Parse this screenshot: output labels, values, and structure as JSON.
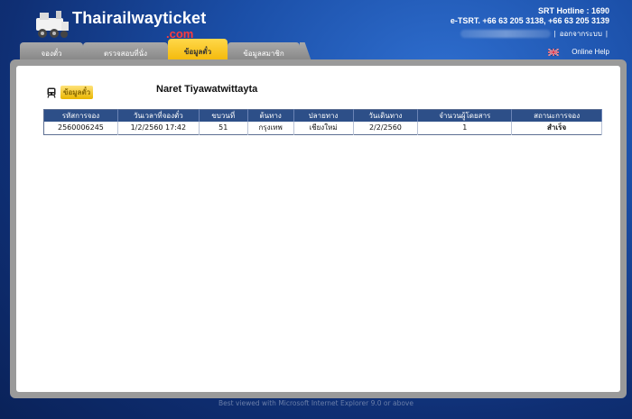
{
  "brand": {
    "name": "Thairailwayticket",
    "suffix": ".com"
  },
  "header": {
    "hotline": "SRT Hotline : 1690",
    "esrt": "e-TSRT. +66 63 205 3138, +66 63 205 3139",
    "logout": "ออกจากระบบ",
    "help": "Online Help"
  },
  "tabs": [
    {
      "label": "จองตั๋ว"
    },
    {
      "label": "ตรวจสอบที่นั่ง"
    },
    {
      "label": "ข้อมูลตั๋ว"
    },
    {
      "label": "ข้อมูลสมาชิก"
    }
  ],
  "section": {
    "label": "ข้อมูลตั๋ว",
    "passenger": "Naret Tiyawatwittayta"
  },
  "table": {
    "headers": [
      "รหัสการจอง",
      "วันเวลาที่จองตั๋ว",
      "ขบวนที่",
      "ต้นทาง",
      "ปลายทาง",
      "วันเดินทาง",
      "จำนวนผู้โดยสาร",
      "สถานะการจอง"
    ],
    "rows": [
      [
        "2560006245",
        "1/2/2560 17:42",
        "51",
        "กรุงเทพ",
        "เชียงใหม่",
        "2/2/2560",
        "1",
        "สำเร็จ"
      ]
    ]
  },
  "footer": "Best viewed with Microsoft Internet Explorer 9.0 or above",
  "colors": {
    "tab_active": "#f2b400",
    "table_header": "#2d4f88",
    "background": "#1b4fa8"
  }
}
